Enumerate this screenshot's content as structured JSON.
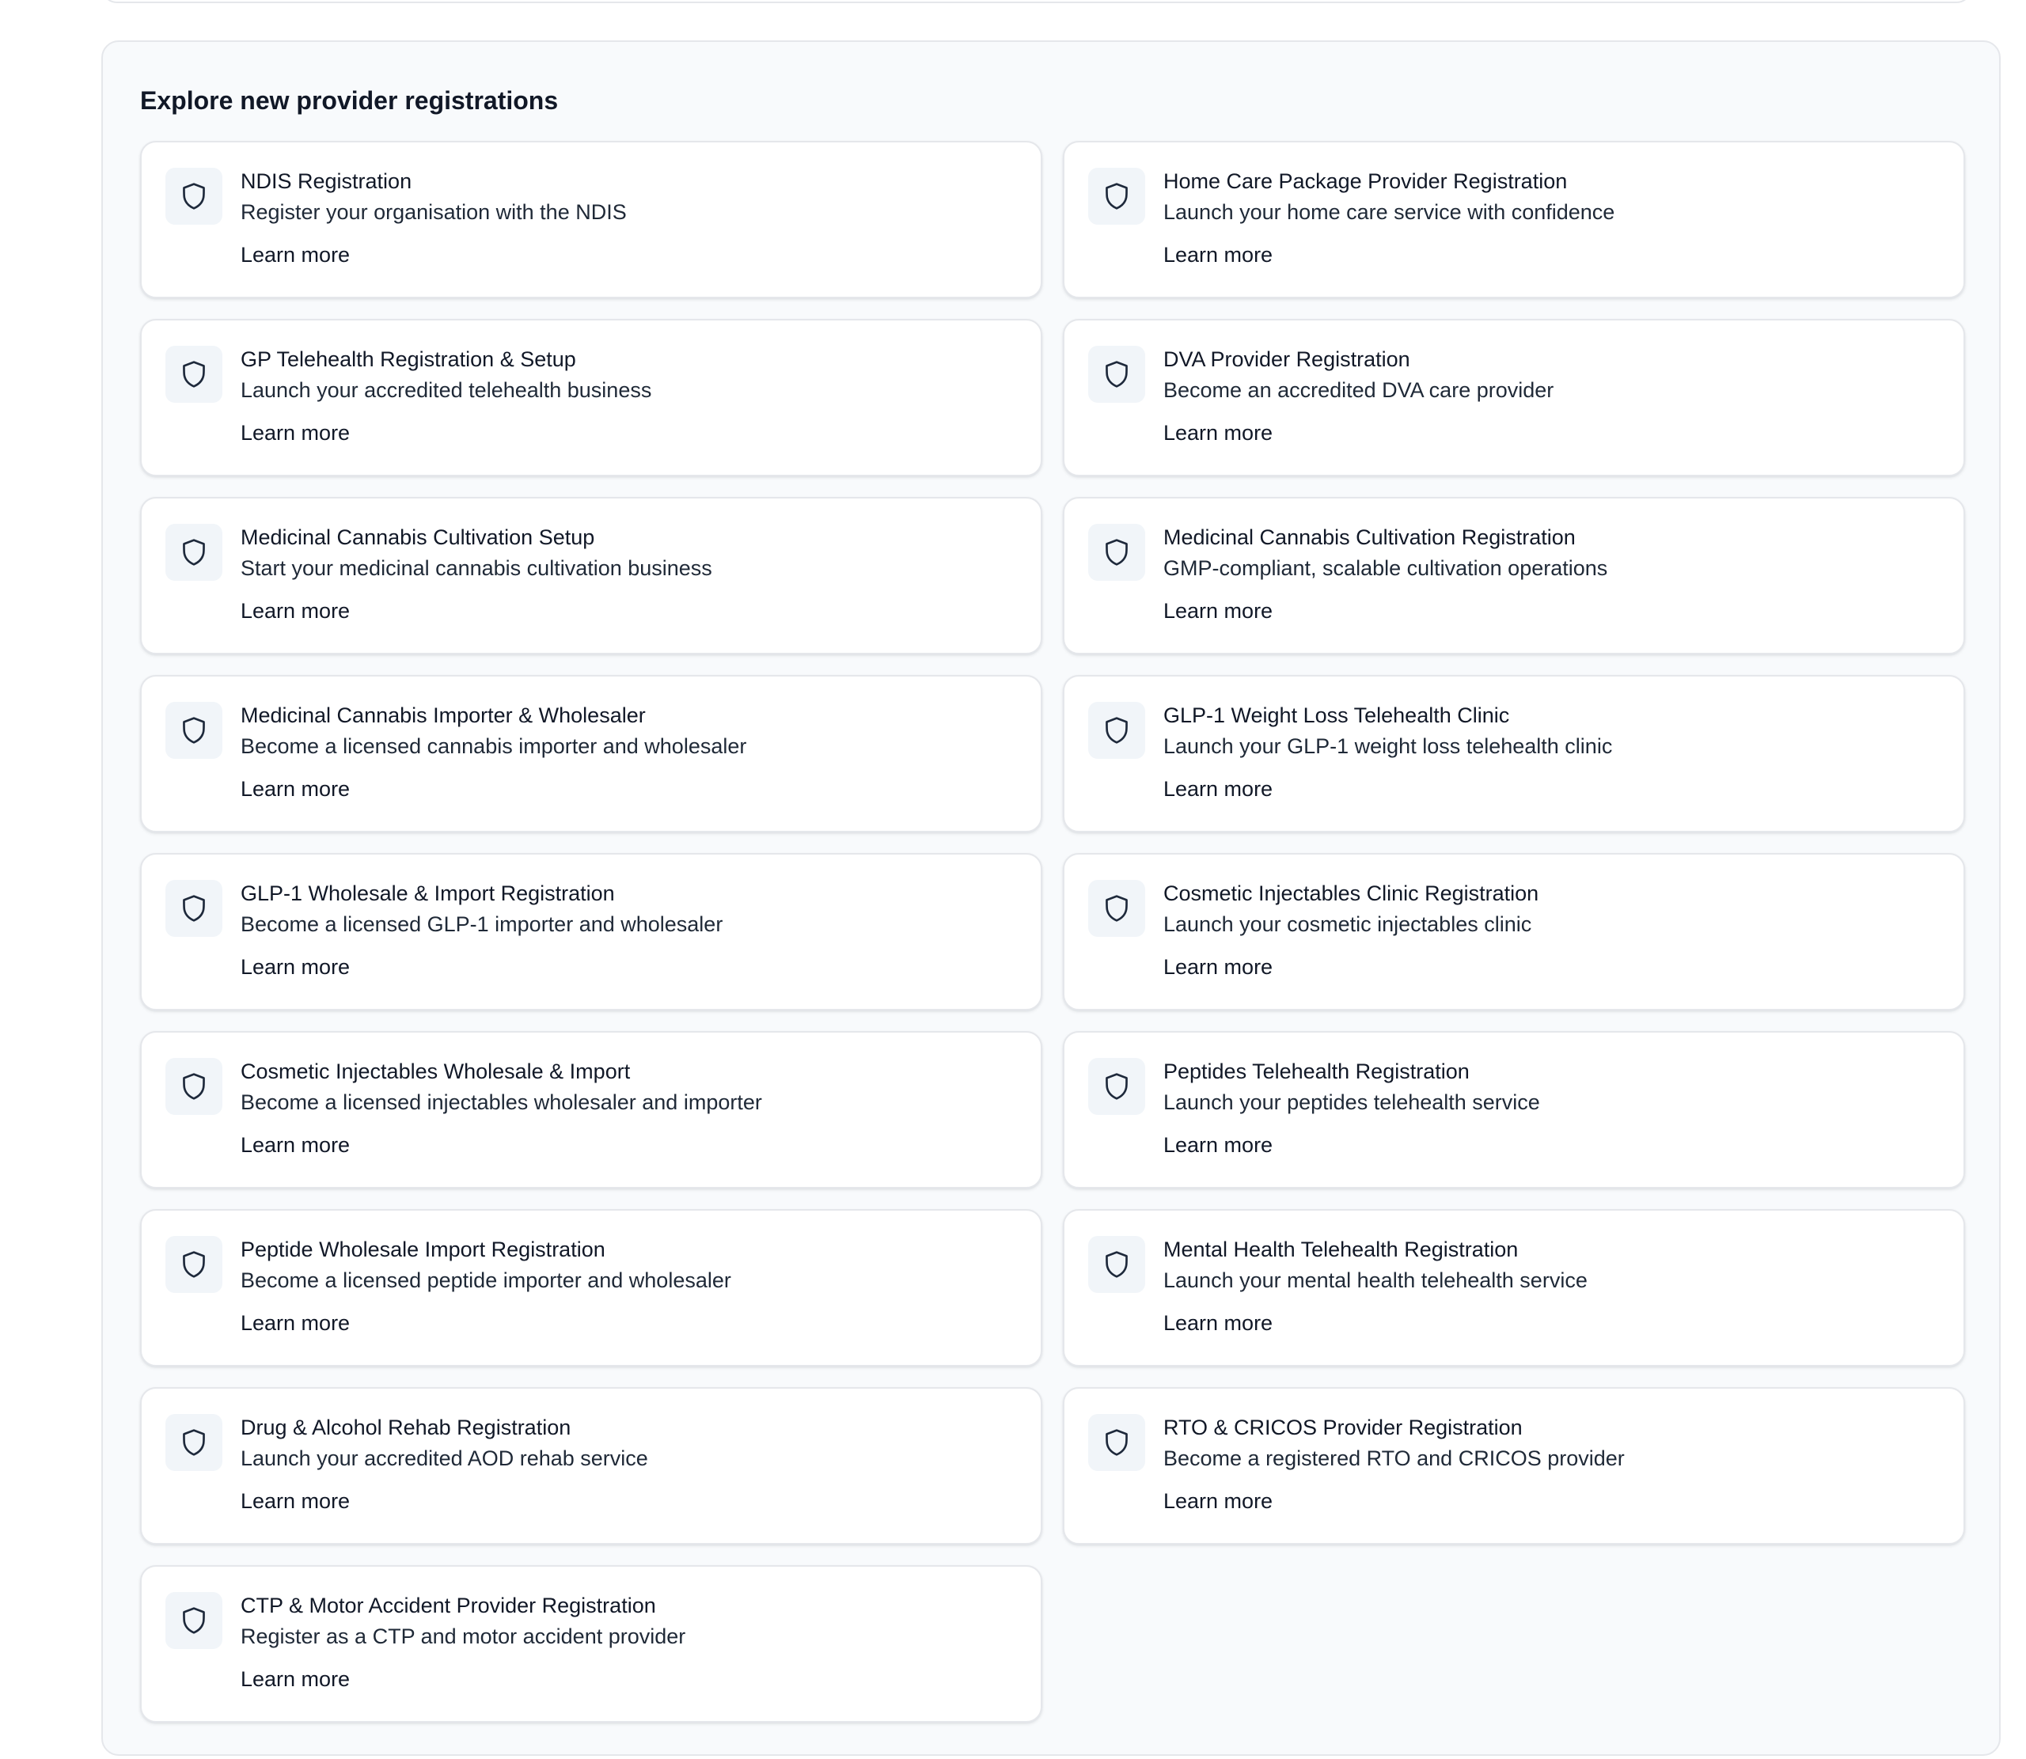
{
  "section": {
    "title": "Explore new provider registrations"
  },
  "cards": [
    {
      "title": "NDIS Registration",
      "description": "Register your organisation with the NDIS",
      "link": "Learn more",
      "icon": "shield-icon"
    },
    {
      "title": "Home Care Package Provider Registration",
      "description": "Launch your home care service with confidence",
      "link": "Learn more",
      "icon": "shield-icon"
    },
    {
      "title": "GP Telehealth Registration & Setup",
      "description": "Launch your accredited telehealth business",
      "link": "Learn more",
      "icon": "shield-icon"
    },
    {
      "title": "DVA Provider Registration",
      "description": "Become an accredited DVA care provider",
      "link": "Learn more",
      "icon": "shield-icon"
    },
    {
      "title": "Medicinal Cannabis Cultivation Setup",
      "description": "Start your medicinal cannabis cultivation business",
      "link": "Learn more",
      "icon": "shield-icon"
    },
    {
      "title": "Medicinal Cannabis Cultivation Registration",
      "description": "GMP-compliant, scalable cultivation operations",
      "link": "Learn more",
      "icon": "shield-icon"
    },
    {
      "title": "Medicinal Cannabis Importer & Wholesaler",
      "description": "Become a licensed cannabis importer and wholesaler",
      "link": "Learn more",
      "icon": "shield-icon"
    },
    {
      "title": "GLP-1 Weight Loss Telehealth Clinic",
      "description": "Launch your GLP-1 weight loss telehealth clinic",
      "link": "Learn more",
      "icon": "shield-icon"
    },
    {
      "title": "GLP-1 Wholesale & Import Registration",
      "description": "Become a licensed GLP-1 importer and wholesaler",
      "link": "Learn more",
      "icon": "shield-icon"
    },
    {
      "title": "Cosmetic Injectables Clinic Registration",
      "description": "Launch your cosmetic injectables clinic",
      "link": "Learn more",
      "icon": "shield-icon"
    },
    {
      "title": "Cosmetic Injectables Wholesale & Import",
      "description": "Become a licensed injectables wholesaler and importer",
      "link": "Learn more",
      "icon": "shield-icon"
    },
    {
      "title": "Peptides Telehealth Registration",
      "description": "Launch your peptides telehealth service",
      "link": "Learn more",
      "icon": "shield-icon"
    },
    {
      "title": "Peptide Wholesale Import Registration",
      "description": "Become a licensed peptide importer and wholesaler",
      "link": "Learn more",
      "icon": "shield-icon"
    },
    {
      "title": "Mental Health Telehealth Registration",
      "description": "Launch your mental health telehealth service",
      "link": "Learn more",
      "icon": "shield-icon"
    },
    {
      "title": "Drug & Alcohol Rehab Registration",
      "description": "Launch your accredited AOD rehab service",
      "link": "Learn more",
      "icon": "shield-icon"
    },
    {
      "title": "RTO & CRICOS Provider Registration",
      "description": "Become a registered RTO and CRICOS provider",
      "link": "Learn more",
      "icon": "shield-icon"
    },
    {
      "title": "CTP & Motor Accident Provider Registration",
      "description": "Register as a CTP and motor accident provider",
      "link": "Learn more",
      "icon": "shield-icon"
    }
  ],
  "colors": {
    "section_background": "#f8fafc",
    "card_background": "#ffffff",
    "border": "#e5e7eb",
    "icon_background": "#f1f5f9",
    "icon_stroke": "#1e293b",
    "text": "#111827"
  }
}
